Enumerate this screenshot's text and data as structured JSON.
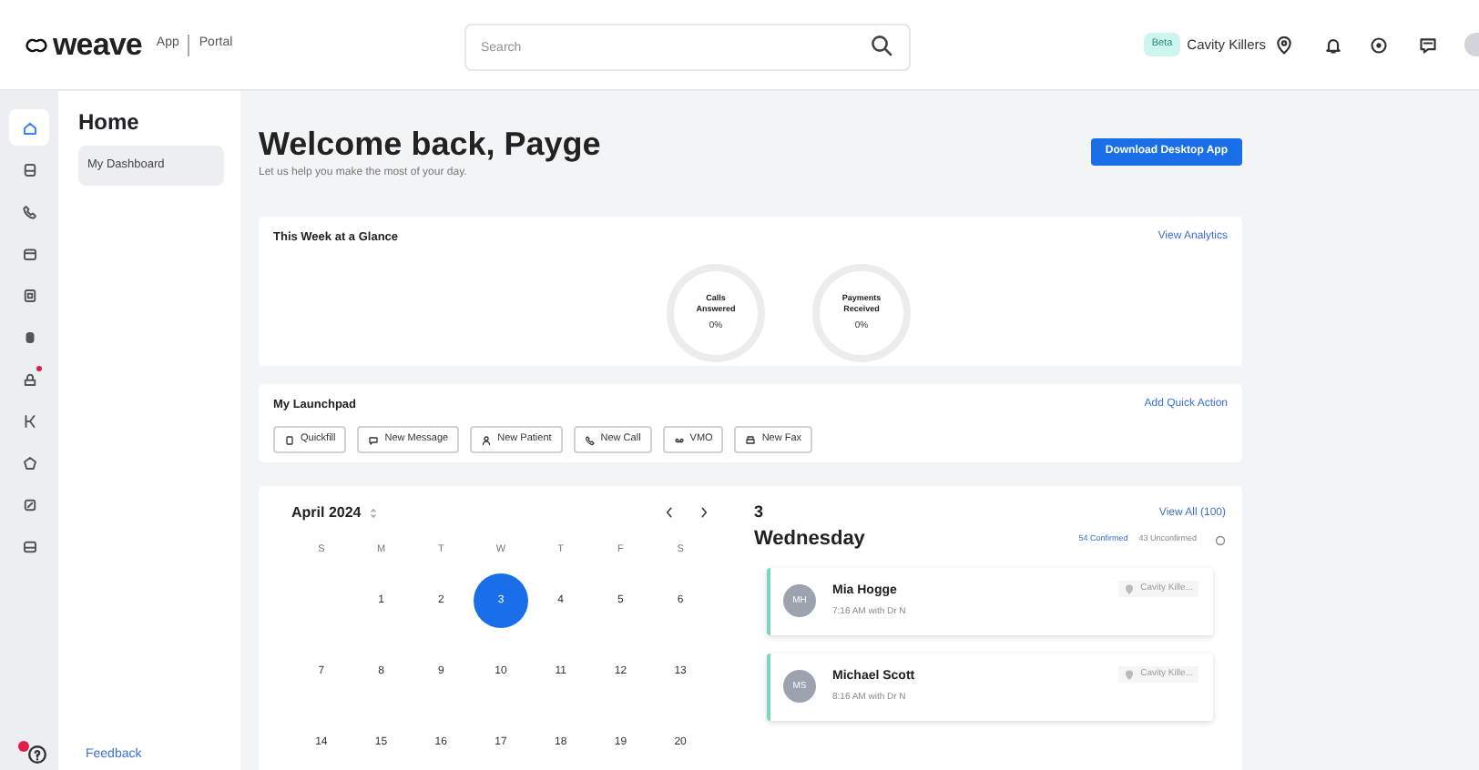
{
  "header": {
    "logo": "weave",
    "app_link": "App",
    "portal_link": "Portal",
    "search": {
      "placeholder": "Search"
    },
    "beta_badge": "Beta",
    "location": "Cavity Killers"
  },
  "rail": {
    "items": [
      {
        "selected": true,
        "dot": false
      },
      {
        "selected": false,
        "dot": false
      },
      {
        "selected": false,
        "dot": false
      },
      {
        "selected": false,
        "dot": false
      },
      {
        "selected": false,
        "dot": false
      },
      {
        "selected": false,
        "dot": false
      },
      {
        "selected": false,
        "dot": true
      },
      {
        "selected": false,
        "dot": false
      },
      {
        "selected": false,
        "dot": false
      },
      {
        "selected": false,
        "dot": false
      },
      {
        "selected": false,
        "dot": false
      }
    ],
    "help_dot": true
  },
  "sidebar": {
    "title": "Home",
    "items": [
      {
        "label": "My Dashboard",
        "selected": true
      }
    ],
    "feedback": "Feedback"
  },
  "welcome": {
    "title": "Welcome back, Payge",
    "subtitle": "Let us help you make the most of your day.",
    "download_button": "Download Desktop App"
  },
  "glance": {
    "title": "This Week at a Glance",
    "link": "View Analytics",
    "gauges": [
      {
        "label": "Calls Answered",
        "value": "0%"
      },
      {
        "label": "Payments Received",
        "value": "0%"
      }
    ]
  },
  "launchpad": {
    "title": "My Launchpad",
    "link": "Add Quick Action",
    "actions": [
      "Quickfill",
      "New Message",
      "New Patient",
      "New Call",
      "VMO",
      "New Fax"
    ]
  },
  "calendar": {
    "month": "April 2024",
    "weekdays": [
      "S",
      "M",
      "T",
      "W",
      "T",
      "F",
      "S"
    ],
    "weeks": [
      [
        {
          "day": "1",
          "selected": false
        },
        {
          "day": "2",
          "selected": false
        },
        {
          "day": "3",
          "selected": true
        },
        {
          "day": "4",
          "selected": false
        },
        {
          "day": "5",
          "selected": false
        },
        {
          "day": "6",
          "selected": false
        }
      ],
      [
        {
          "day": "7",
          "selected": false
        },
        {
          "day": "8",
          "selected": false
        },
        {
          "day": "9",
          "selected": false
        },
        {
          "day": "10",
          "selected": false
        },
        {
          "day": "11",
          "selected": false
        },
        {
          "day": "12",
          "selected": false
        },
        {
          "day": "13",
          "selected": false
        }
      ],
      [
        {
          "day": "14",
          "selected": false
        },
        {
          "day": "15",
          "selected": false
        },
        {
          "day": "16",
          "selected": false
        },
        {
          "day": "17",
          "selected": false
        },
        {
          "day": "18",
          "selected": false
        },
        {
          "day": "19",
          "selected": false
        },
        {
          "day": "20",
          "selected": false
        }
      ]
    ]
  },
  "schedule": {
    "date": "3",
    "weekday": "Wednesday",
    "view_all": "View All (100)",
    "confirmed": "54 Confirmed",
    "unconfirmed": "43 Unconfirmed",
    "appointments": [
      {
        "initials": "MH",
        "name": "Mia Hogge",
        "time": "7:16 AM with Dr N",
        "location": "Cavity Kille..."
      },
      {
        "initials": "MS",
        "name": "Michael Scott",
        "time": "8:16 AM with Dr N",
        "location": "Cavity Kille..."
      }
    ]
  }
}
